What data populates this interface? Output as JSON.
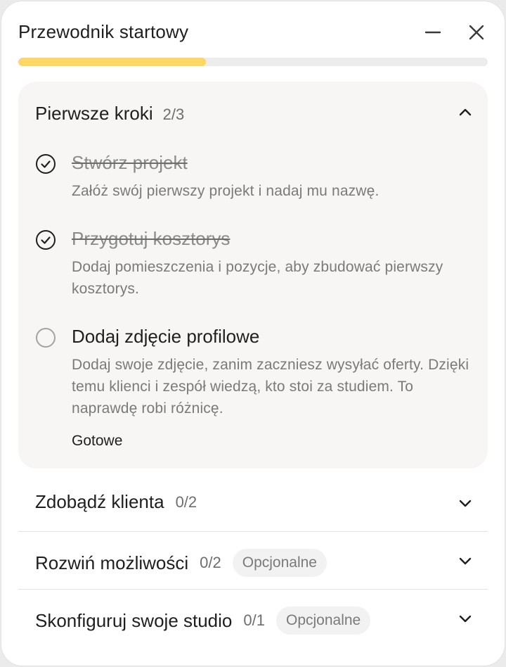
{
  "header": {
    "title": "Przewodnik startowy",
    "minimize_icon": "minus-icon",
    "close_icon": "close-icon"
  },
  "progress": {
    "fraction": 0.4
  },
  "colors": {
    "progress_fill": "#fdd763",
    "progress_track": "#ececec",
    "section_bg": "#f7f6f4"
  },
  "sections": [
    {
      "title": "Pierwsze kroki",
      "count": "2/3",
      "expanded": true,
      "steps": [
        {
          "title": "Stwórz projekt",
          "done": true,
          "description": "Załóż swój pierwszy projekt i nadaj mu nazwę."
        },
        {
          "title": "Przygotuj kosztorys",
          "done": true,
          "description": "Dodaj pomieszczenia i pozycje, aby zbudować pierwszy kosztorys."
        },
        {
          "title": "Dodaj zdjęcie profilowe",
          "done": false,
          "description": "Dodaj swoje zdjęcie, zanim zaczniesz wysyłać oferty. Dzięki temu klienci i zespół wiedzą, kto stoi za studiem. To naprawdę robi różnicę.",
          "action": "Gotowe"
        }
      ]
    },
    {
      "title": "Zdobądź klienta",
      "count": "0/2",
      "expanded": false
    },
    {
      "title": "Rozwiń możliwości",
      "count": "0/2",
      "badge": "Opcjonalne",
      "expanded": false
    },
    {
      "title": "Skonfiguruj swoje studio",
      "count": "0/1",
      "badge": "Opcjonalne",
      "expanded": false
    }
  ]
}
